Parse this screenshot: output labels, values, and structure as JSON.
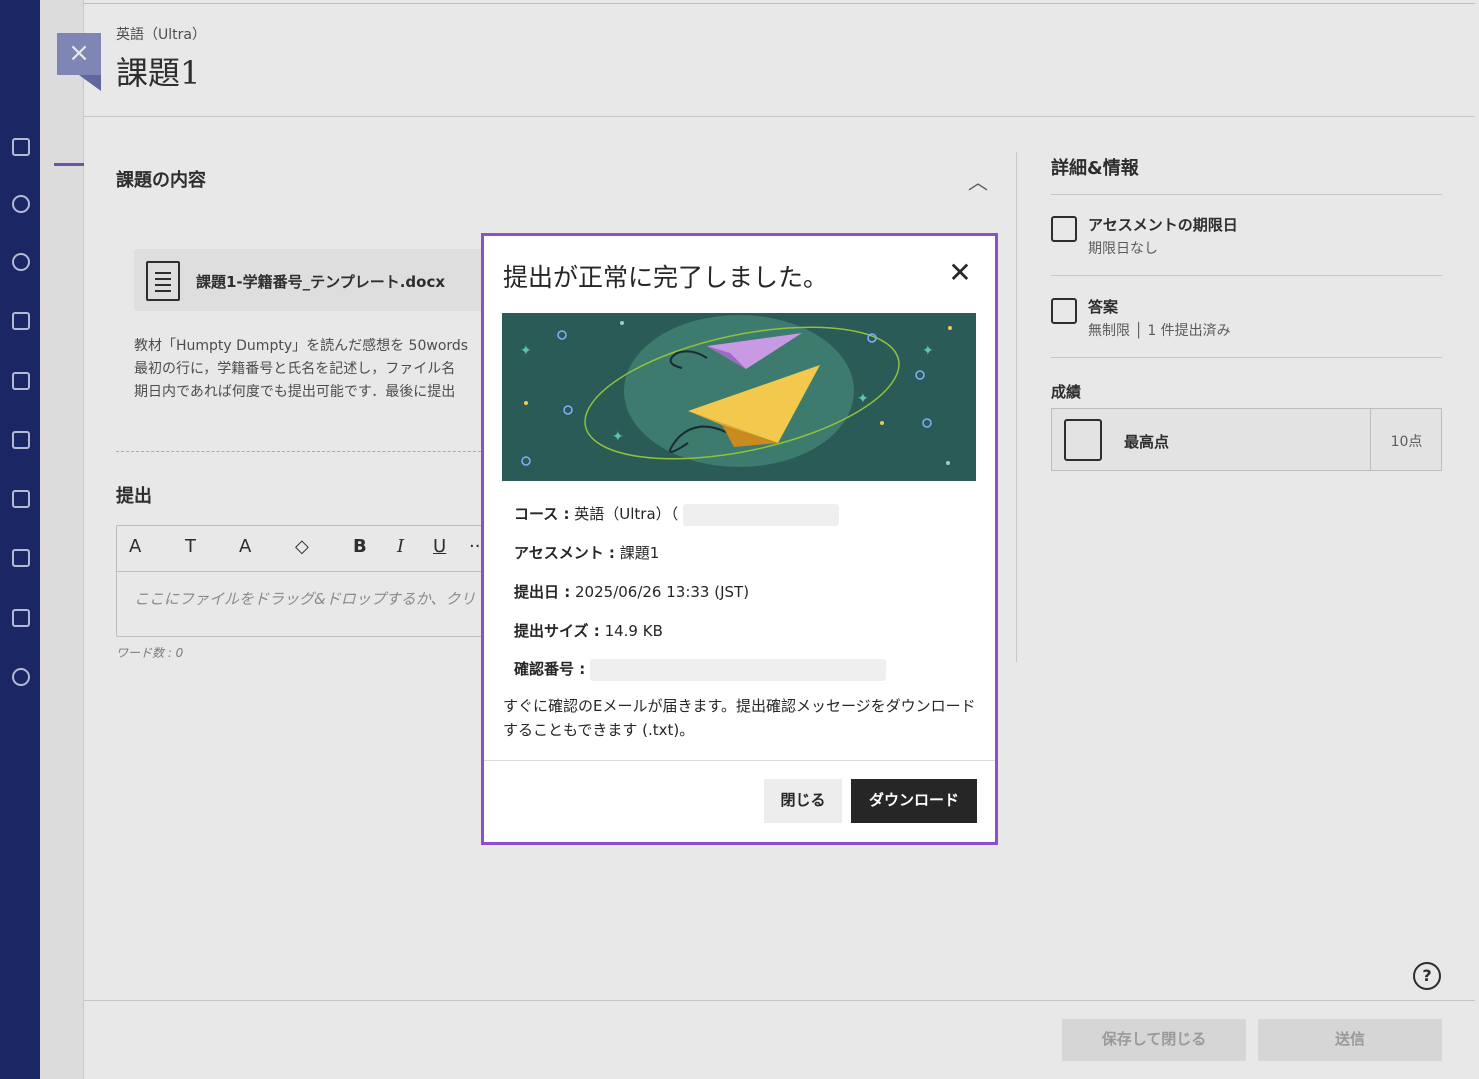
{
  "panel": {
    "course_label": "英語（Ultra）",
    "title": "課題1",
    "content_section_title": "課題の内容",
    "attachment_name": "課題1-学籍番号_テンプレート.docx",
    "instructions": [
      "教材「Humpty Dumpty」を読んだ感想を 50words",
      "最初の行に，学籍番号と氏名を記述し，ファイル名",
      "期日内であれば何度でも提出可能です．最後に提出"
    ],
    "submission_section_title": "提出",
    "editor_placeholder": "ここにファイルをドラッグ&ドロップするか、クリ",
    "word_count": "ワード数 : 0",
    "editor_toolbar": [
      "A",
      "T",
      "A",
      "◇",
      "B",
      "I",
      "U",
      "··"
    ]
  },
  "details": {
    "title": "詳細&情報",
    "due_label": "アセスメントの期限日",
    "due_value": "期限日なし",
    "attempts_label": "答案",
    "attempts_value": "無制限 │ 1 件提出済み",
    "grade_section": "成績",
    "grade_label": "最高点",
    "grade_value": "10点"
  },
  "footer": {
    "save_close": "保存して閉じる",
    "submit": "送信"
  },
  "modal": {
    "title": "提出が正常に完了しました。",
    "course_key": "コース :",
    "course_value": "英語（Ultra）（",
    "assessment_key": "アセスメント :",
    "assessment_value": "課題1",
    "date_key": "提出日 :",
    "date_value": "2025/06/26 13:33 (JST)",
    "size_key": "提出サイズ :",
    "size_value": "14.9 KB",
    "confirm_key": "確認番号 :",
    "note": "すぐに確認のEメールが届きます。提出確認メッセージをダウンロードすることもできます (.txt)。",
    "close_label": "閉じる",
    "download_label": "ダウンロード"
  },
  "colors": {
    "modal_border": "#8b4fd0",
    "banner_bg": "#2b5b56",
    "nav_bg": "#1e2a6e",
    "primary_button": "#262626"
  }
}
